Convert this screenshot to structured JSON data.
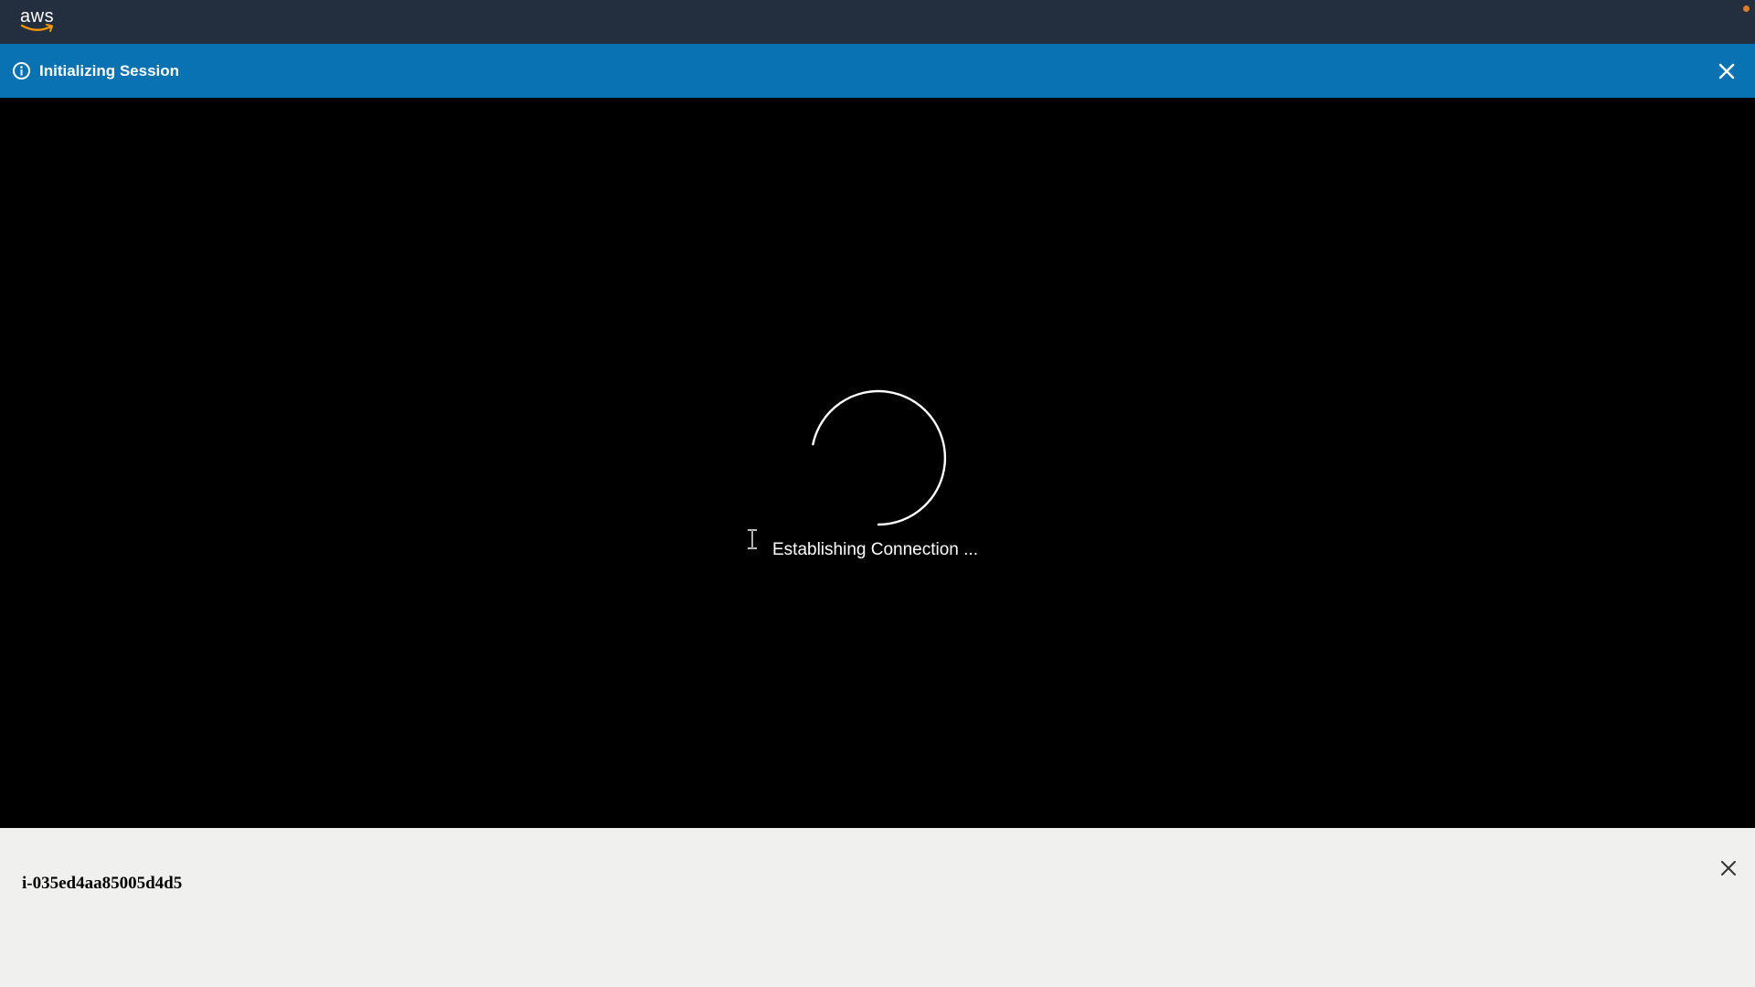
{
  "header": {
    "logo_text": "aws",
    "logo_icon": "aws-smile-icon",
    "status_dot_color": "#e07b26"
  },
  "banner": {
    "icon": "info-icon",
    "text": "Initializing Session",
    "close_icon": "close-icon",
    "background_color": "#0972b3"
  },
  "terminal": {
    "spinner_icon": "loading-spinner-icon",
    "cursor_icon": "text-cursor-icon",
    "status_text": "Establishing Connection ..."
  },
  "footer": {
    "instance_id": "i-035ed4aa85005d4d5",
    "close_icon": "close-icon"
  }
}
